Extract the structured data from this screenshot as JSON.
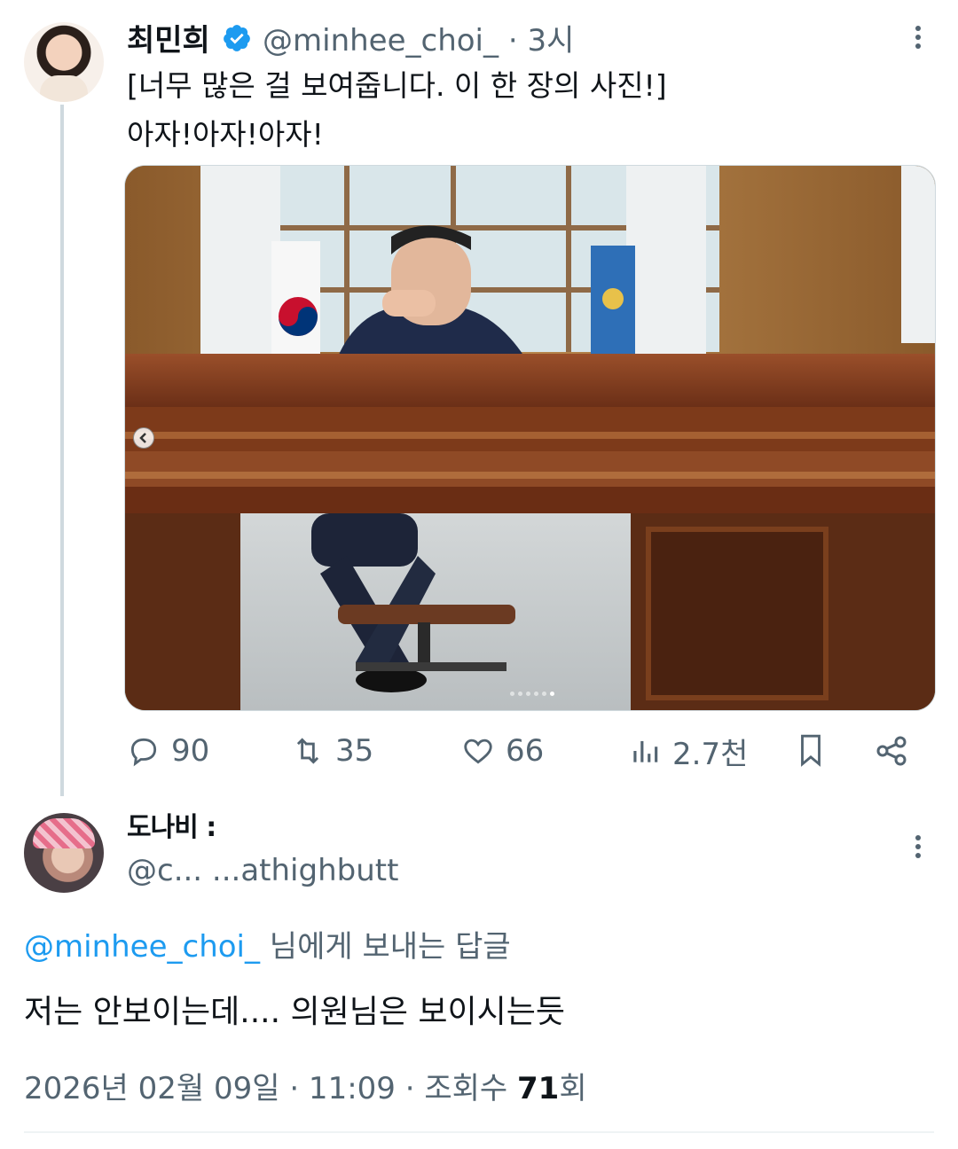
{
  "tweet": {
    "author_name": "최민희",
    "author_handle": "@minhee_choi_",
    "separator": "·",
    "time": "3시",
    "text_line1": "[너무 많은 걸 보여줍니다. 이 한 장의 사진!]",
    "text_line2": "아자!아자!아자!",
    "verified_icon": "verified-badge-icon",
    "carousel": {
      "total_dots": 6,
      "active_dot": 6
    },
    "actions": {
      "replies": "90",
      "retweets": "35",
      "likes": "66",
      "views": "2.7천"
    }
  },
  "reply": {
    "author_name": "도나비 :",
    "author_handle": "@c... ...athighbutt",
    "reply_to_mention": "@minhee_choi_",
    "reply_to_suffix": " 님에게 보내는 답글",
    "text": "저는 안보이는데.... 의원님은 보이시는듯",
    "meta_date": "2026년 02월 09일 · 11:09 · 조회수 ",
    "meta_views": "71",
    "meta_views_suffix": "회"
  },
  "colors": {
    "text_primary": "#0f1419",
    "text_secondary": "#536471",
    "link_blue": "#1d9bf0",
    "thread_line": "#cfd9de"
  }
}
